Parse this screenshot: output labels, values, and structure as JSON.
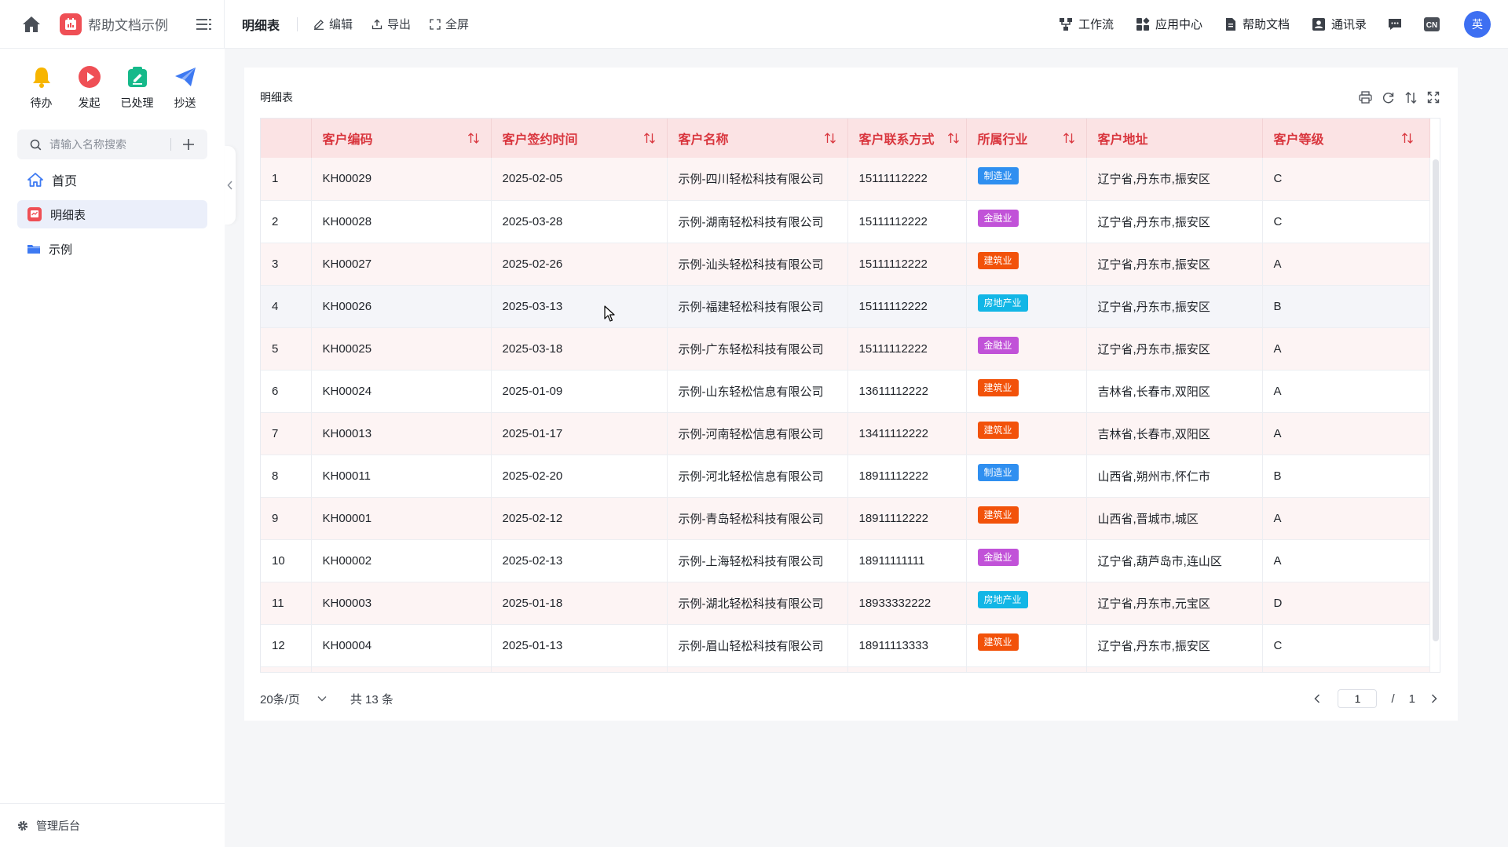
{
  "header": {
    "app_name": "帮助文档示例",
    "page_title": "明细表",
    "tools": [
      {
        "label": "编辑",
        "icon": "edit-icon"
      },
      {
        "label": "导出",
        "icon": "export-icon"
      },
      {
        "label": "全屏",
        "icon": "fullscreen-icon"
      }
    ],
    "nav": [
      {
        "label": "工作流",
        "icon": "workflow-icon"
      },
      {
        "label": "应用中心",
        "icon": "app-center-icon"
      },
      {
        "label": "帮助文档",
        "icon": "document-icon"
      },
      {
        "label": "通讯录",
        "icon": "contacts-icon"
      }
    ],
    "lang_badge": "CN",
    "avatar_text": "英"
  },
  "sidebar": {
    "quick": [
      {
        "label": "待办",
        "icon": "bell-icon",
        "color": "#f7b500"
      },
      {
        "label": "发起",
        "icon": "play-icon",
        "color": "#ef4f55"
      },
      {
        "label": "已处理",
        "icon": "done-icon",
        "color": "#16b98a"
      },
      {
        "label": "抄送",
        "icon": "send-icon",
        "color": "#3d79f2"
      }
    ],
    "search_placeholder": "请输入名称搜索",
    "items": [
      {
        "label": "首页",
        "icon": "home-icon"
      },
      {
        "label": "明细表",
        "icon": "report-icon",
        "active": true
      },
      {
        "label": "示例",
        "icon": "folder-icon"
      }
    ],
    "footer_label": "管理后台"
  },
  "card": {
    "title": "明细表"
  },
  "table": {
    "columns": [
      "",
      "客户编码",
      "客户签约时间",
      "客户名称",
      "客户联系方式",
      "所属行业",
      "客户地址",
      "客户等级"
    ],
    "rows": [
      {
        "no": "1",
        "code": "KH00029",
        "date": "2025-02-05",
        "name": "示例-四川轻松科技有限公司",
        "phone": "15111112222",
        "industry": "制造业",
        "address": "辽宁省,丹东市,振安区",
        "level": "C"
      },
      {
        "no": "2",
        "code": "KH00028",
        "date": "2025-03-28",
        "name": "示例-湖南轻松科技有限公司",
        "phone": "15111112222",
        "industry": "金融业",
        "address": "辽宁省,丹东市,振安区",
        "level": "C"
      },
      {
        "no": "3",
        "code": "KH00027",
        "date": "2025-02-26",
        "name": "示例-汕头轻松科技有限公司",
        "phone": "15111112222",
        "industry": "建筑业",
        "address": "辽宁省,丹东市,振安区",
        "level": "A"
      },
      {
        "no": "4",
        "code": "KH00026",
        "date": "2025-03-13",
        "name": "示例-福建轻松科技有限公司",
        "phone": "15111112222",
        "industry": "房地产业",
        "address": "辽宁省,丹东市,振安区",
        "level": "B"
      },
      {
        "no": "5",
        "code": "KH00025",
        "date": "2025-03-18",
        "name": "示例-广东轻松科技有限公司",
        "phone": "15111112222",
        "industry": "金融业",
        "address": "辽宁省,丹东市,振安区",
        "level": "A"
      },
      {
        "no": "6",
        "code": "KH00024",
        "date": "2025-01-09",
        "name": "示例-山东轻松信息有限公司",
        "phone": "13611112222",
        "industry": "建筑业",
        "address": "吉林省,长春市,双阳区",
        "level": "A"
      },
      {
        "no": "7",
        "code": "KH00013",
        "date": "2025-01-17",
        "name": "示例-河南轻松信息有限公司",
        "phone": "13411112222",
        "industry": "建筑业",
        "address": "吉林省,长春市,双阳区",
        "level": "A"
      },
      {
        "no": "8",
        "code": "KH00011",
        "date": "2025-02-20",
        "name": "示例-河北轻松信息有限公司",
        "phone": "18911112222",
        "industry": "制造业",
        "address": "山西省,朔州市,怀仁市",
        "level": "B"
      },
      {
        "no": "9",
        "code": "KH00001",
        "date": "2025-02-12",
        "name": "示例-青岛轻松科技有限公司",
        "phone": "18911112222",
        "industry": "建筑业",
        "address": "山西省,晋城市,城区",
        "level": "A"
      },
      {
        "no": "10",
        "code": "KH00002",
        "date": "2025-02-13",
        "name": "示例-上海轻松科技有限公司",
        "phone": "18911111111",
        "industry": "金融业",
        "address": "辽宁省,葫芦岛市,连山区",
        "level": "A"
      },
      {
        "no": "11",
        "code": "KH00003",
        "date": "2025-01-18",
        "name": "示例-湖北轻松科技有限公司",
        "phone": "18933332222",
        "industry": "房地产业",
        "address": "辽宁省,丹东市,元宝区",
        "level": "D"
      },
      {
        "no": "12",
        "code": "KH00004",
        "date": "2025-01-13",
        "name": "示例-眉山轻松科技有限公司",
        "phone": "18911113333",
        "industry": "建筑业",
        "address": "辽宁省,丹东市,振安区",
        "level": "C"
      }
    ],
    "industry_colors": {
      "制造业": "#2f8ff0",
      "金融业": "#c152d8",
      "建筑业": "#f2520a",
      "房地产业": "#12b6e6"
    },
    "partial_last_row_tag_color": "#c152d8"
  },
  "pager": {
    "page_size": "20条/页",
    "total": "共 13 条",
    "current_page": "1",
    "slash": "/",
    "total_pages": "1"
  }
}
